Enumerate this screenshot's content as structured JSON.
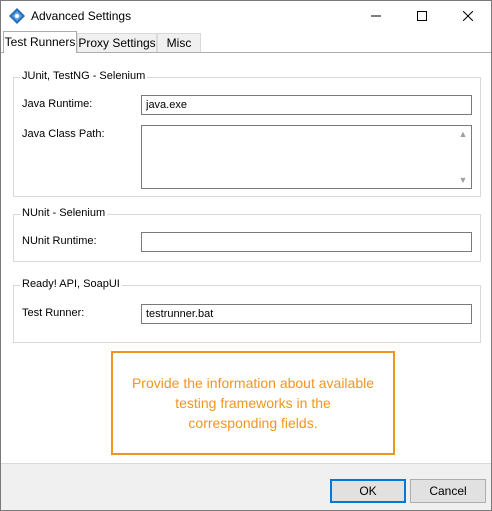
{
  "window": {
    "title": "Advanced Settings"
  },
  "tabs": [
    {
      "label": "Test Runners",
      "active": true
    },
    {
      "label": "Proxy Settings",
      "active": false
    },
    {
      "label": "Misc",
      "active": false
    }
  ],
  "groups": {
    "junit": {
      "title": "JUnit, TestNG - Selenium",
      "java_runtime_label": "Java Runtime:",
      "java_runtime_value": "java.exe",
      "java_class_path_label": "Java Class Path:",
      "java_class_path_value": ""
    },
    "nunit": {
      "title": "NUnit - Selenium",
      "nunit_runtime_label": "NUnit Runtime:",
      "nunit_runtime_value": ""
    },
    "readyapi": {
      "title": "Ready! API, SoapUI",
      "test_runner_label": "Test Runner:",
      "test_runner_value": "testrunner.bat"
    }
  },
  "callout": {
    "text": "Provide the information about available testing frameworks in the corresponding fields."
  },
  "buttons": {
    "ok": "OK",
    "cancel": "Cancel"
  },
  "colors": {
    "callout": "#f0961e",
    "accent": "#0078d7"
  },
  "icons": [
    "app-icon",
    "minimize-icon",
    "maximize-icon",
    "close-icon",
    "scroll-up-icon",
    "scroll-down-icon"
  ]
}
